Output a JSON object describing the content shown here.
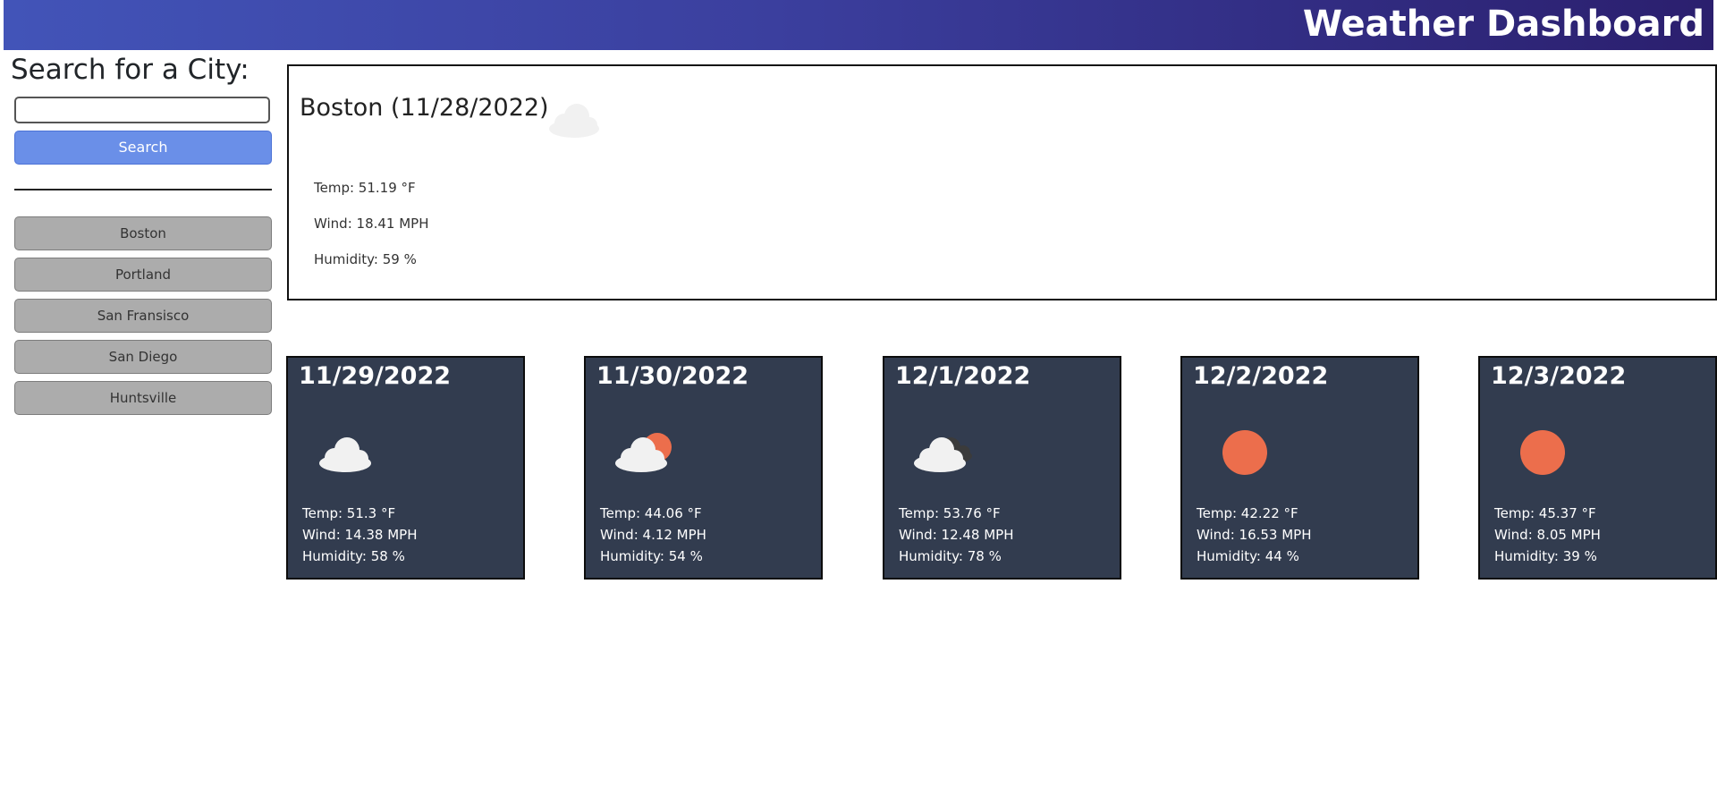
{
  "header": {
    "title": "Weather Dashboard"
  },
  "sidebar": {
    "heading": "Search for a City:",
    "search_placeholder": "",
    "search_button": "Search",
    "history": [
      "Boston",
      "Portland",
      "San Fransisco",
      "San Diego",
      "Huntsville"
    ]
  },
  "current": {
    "title": "Boston (11/28/2022)",
    "icon": "cloud-icon",
    "temp": "Temp: 51.19 °F",
    "wind": "Wind: 18.41 MPH",
    "humidity": "Humidity: 59 %"
  },
  "forecast": [
    {
      "date": "11/29/2022",
      "icon": "cloud-icon",
      "temp": "Temp: 51.3 °F",
      "wind": "Wind: 14.38 MPH",
      "humidity": "Humidity: 58 %"
    },
    {
      "date": "11/30/2022",
      "icon": "partly-cloudy-sun-icon",
      "temp": "Temp: 44.06 °F",
      "wind": "Wind: 4.12 MPH",
      "humidity": "Humidity: 54 %"
    },
    {
      "date": "12/1/2022",
      "icon": "broken-clouds-icon",
      "temp": "Temp: 53.76 °F",
      "wind": "Wind: 12.48 MPH",
      "humidity": "Humidity: 78 %"
    },
    {
      "date": "12/2/2022",
      "icon": "sun-icon",
      "temp": "Temp: 42.22 °F",
      "wind": "Wind: 16.53 MPH",
      "humidity": "Humidity: 44 %"
    },
    {
      "date": "12/3/2022",
      "icon": "sun-icon",
      "temp": "Temp: 45.37 °F",
      "wind": "Wind: 8.05 MPH",
      "humidity": "Humidity: 39 %"
    }
  ],
  "colors": {
    "header_start": "#4254b8",
    "header_end": "#2b1f6e",
    "search_button": "#6a8fe8",
    "history_button": "#acacac",
    "card_background": "#323c4f",
    "sun": "#ec6e4c",
    "cloud": "#f1f1f1",
    "dark_cloud": "#3b3b3b"
  }
}
